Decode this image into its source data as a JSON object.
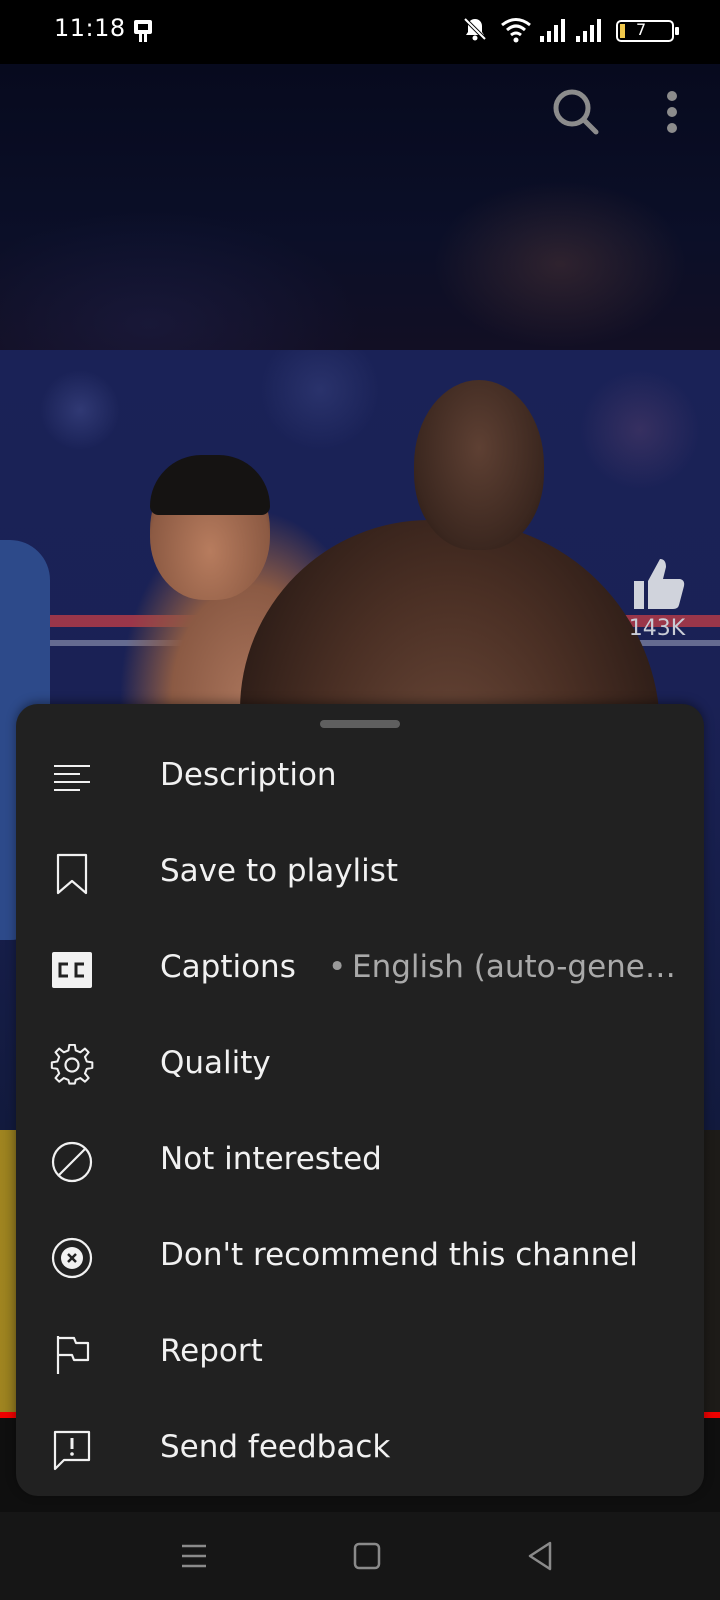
{
  "status_bar": {
    "time": "11:18",
    "battery_level": "7",
    "icons": [
      "sim-notification-icon",
      "mute-icon",
      "wifi-icon",
      "signal-icon",
      "signal-icon",
      "battery-icon"
    ]
  },
  "player": {
    "like_count": "143K",
    "top_icons": [
      "search-icon",
      "more-options-icon"
    ]
  },
  "bottom_sheet": {
    "items": [
      {
        "label": "Description",
        "icon": "description-icon"
      },
      {
        "label": "Save to playlist",
        "icon": "bookmark-icon"
      },
      {
        "label": "Captions",
        "icon": "cc-icon",
        "separator": "•",
        "value": "English (auto-genera…"
      },
      {
        "label": "Quality",
        "icon": "gear-icon"
      },
      {
        "label": "Not interested",
        "icon": "block-icon"
      },
      {
        "label": "Don't recommend this channel",
        "icon": "close-circle-icon"
      },
      {
        "label": "Report",
        "icon": "flag-icon"
      },
      {
        "label": "Send feedback",
        "icon": "feedback-icon"
      }
    ]
  },
  "system_nav": {
    "icons": [
      "menu-icon",
      "home-icon",
      "back-icon"
    ]
  },
  "colors": {
    "sheet_background": "#212121",
    "text_primary": "#f1f1f1",
    "text_secondary": "#a9a9a9",
    "progress_red": "#ee0000"
  }
}
